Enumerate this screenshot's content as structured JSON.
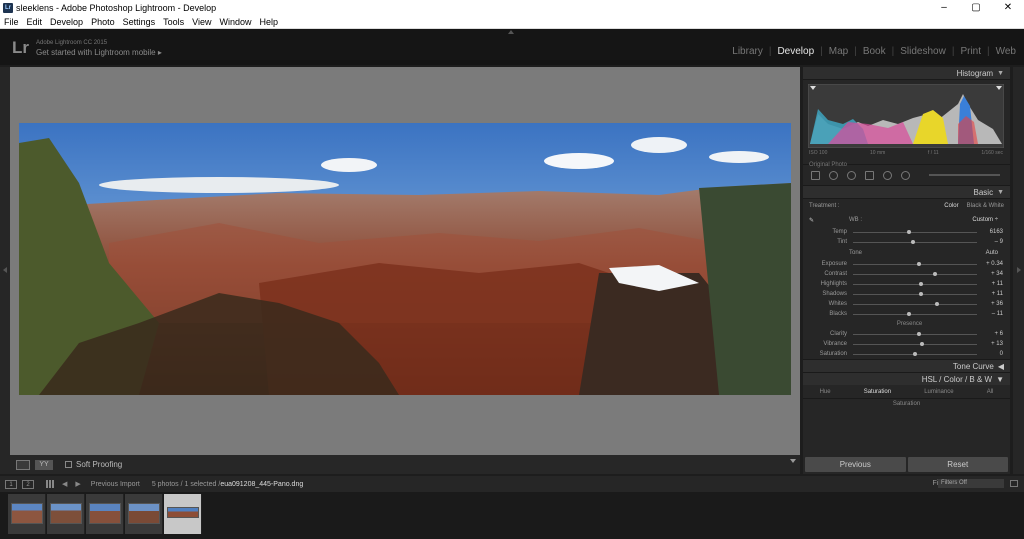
{
  "window": {
    "title": "sleeklens - Adobe Photoshop Lightroom - Develop",
    "controls": [
      "–",
      "▢",
      "✕"
    ]
  },
  "menu": [
    "File",
    "Edit",
    "Develop",
    "Photo",
    "Settings",
    "Tools",
    "View",
    "Window",
    "Help"
  ],
  "identity": {
    "logo": "Lr",
    "line1": "Adobe Lightroom CC 2015",
    "line2": "Get started with Lightroom mobile ▸"
  },
  "modules": [
    {
      "label": "Library",
      "active": false
    },
    {
      "label": "Develop",
      "active": true
    },
    {
      "label": "Map",
      "active": false
    },
    {
      "label": "Book",
      "active": false
    },
    {
      "label": "Slideshow",
      "active": false
    },
    {
      "label": "Print",
      "active": false
    },
    {
      "label": "Web",
      "active": false
    }
  ],
  "toolbar": {
    "view_mode": "YY",
    "soft_proofing": "Soft Proofing"
  },
  "panels": {
    "histogram": {
      "label": "Histogram",
      "info": [
        "ISO 100",
        "10 mm",
        "f / 11",
        "1/160 sec"
      ],
      "original_photo": "Original Photo"
    },
    "basic": {
      "label": "Basic",
      "treatment": "Treatment :",
      "treatment_color": "Color",
      "treatment_bw": "Black & White",
      "wb_label": "WB :",
      "wb_value": "Custom ÷",
      "tone_label": "Tone",
      "tone_auto": "Auto",
      "presence_label": "Presence",
      "sliders": [
        {
          "label": "Temp",
          "value": "6163",
          "pos": 0.45
        },
        {
          "label": "Tint",
          "value": "– 9",
          "pos": 0.48
        },
        {
          "label": "Exposure",
          "value": "+ 0.34",
          "pos": 0.53
        },
        {
          "label": "Contrast",
          "value": "+ 34",
          "pos": 0.66
        },
        {
          "label": "Highlights",
          "value": "+ 11",
          "pos": 0.55
        },
        {
          "label": "Shadows",
          "value": "+ 11",
          "pos": 0.55
        },
        {
          "label": "Whites",
          "value": "+ 36",
          "pos": 0.68
        },
        {
          "label": "Blacks",
          "value": "– 11",
          "pos": 0.45
        },
        {
          "label": "Clarity",
          "value": "+ 6",
          "pos": 0.53
        },
        {
          "label": "Vibrance",
          "value": "+ 13",
          "pos": 0.56
        },
        {
          "label": "Saturation",
          "value": "0",
          "pos": 0.5
        }
      ]
    },
    "tone_curve": {
      "label": "Tone Curve"
    },
    "hsl": {
      "label": "HSL / Color / B & W",
      "tabs": [
        "Hue",
        "Saturation",
        "Luminance",
        "All"
      ],
      "active_tab": "Saturation",
      "sub_label": "Saturation"
    }
  },
  "buttons": {
    "previous": "Previous",
    "reset": "Reset"
  },
  "filmstrip": {
    "nav1": "1",
    "nav2": "2",
    "source": "Previous Import",
    "count": "5 photos / 1 selected /",
    "filename": "eua091208_445-Pano.dng",
    "filter_label": "Filter :",
    "filter_value": "Filters Off"
  },
  "colors": {
    "accent": "#e6e6e6",
    "panel_bg": "#262626",
    "center_bg": "#7b7b7b"
  }
}
